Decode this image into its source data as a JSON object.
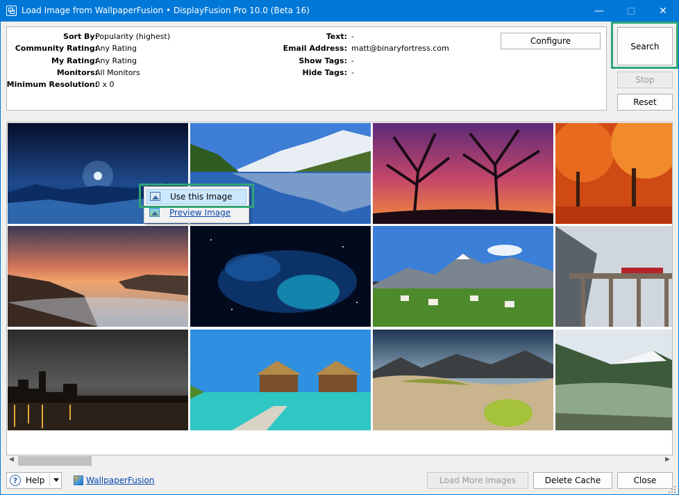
{
  "window": {
    "title": "Load Image from WallpaperFusion • DisplayFusion Pro 10.0 (Beta 16)"
  },
  "controls": {
    "minimize": "—",
    "maximize": "",
    "close": "✕"
  },
  "filters": {
    "left": [
      {
        "label": "Sort By:",
        "value": "Popularity (highest)"
      },
      {
        "label": "Community Rating:",
        "value": "Any Rating"
      },
      {
        "label": "My Rating:",
        "value": "Any Rating"
      },
      {
        "label": "Monitors:",
        "value": "All Monitors"
      },
      {
        "label": "Minimum Resolution:",
        "value": "0 x 0"
      }
    ],
    "right": [
      {
        "label": "Text:",
        "value": "-"
      },
      {
        "label": "Email Address:",
        "value": "matt@binaryfortress.com"
      },
      {
        "label": "Show Tags:",
        "value": "-"
      },
      {
        "label": "Hide Tags:",
        "value": "-"
      }
    ]
  },
  "buttons": {
    "configure": "Configure",
    "search": "Search",
    "stop": "Stop",
    "reset": "Reset",
    "load_more": "Load More Images",
    "delete_cache": "Delete Cache",
    "close": "Close"
  },
  "context_menu": {
    "use_image": "Use this Image",
    "preview_image": "Preview Image"
  },
  "footer": {
    "help": "Help",
    "link": "WallpaperFusion"
  },
  "scrollbar": {
    "left_arrow": "◀",
    "right_arrow": "▶"
  },
  "thumbnails": [
    "moonlit-lake",
    "alpine-lake",
    "sunset-trees",
    "autumn-forest",
    "rocky-coast-sunset",
    "blue-nebula",
    "mountain-village",
    "snowy-railway-viaduct",
    "night-city-skyline",
    "overwater-bungalows",
    "desert-dunes",
    "mountain-valley-lake"
  ]
}
